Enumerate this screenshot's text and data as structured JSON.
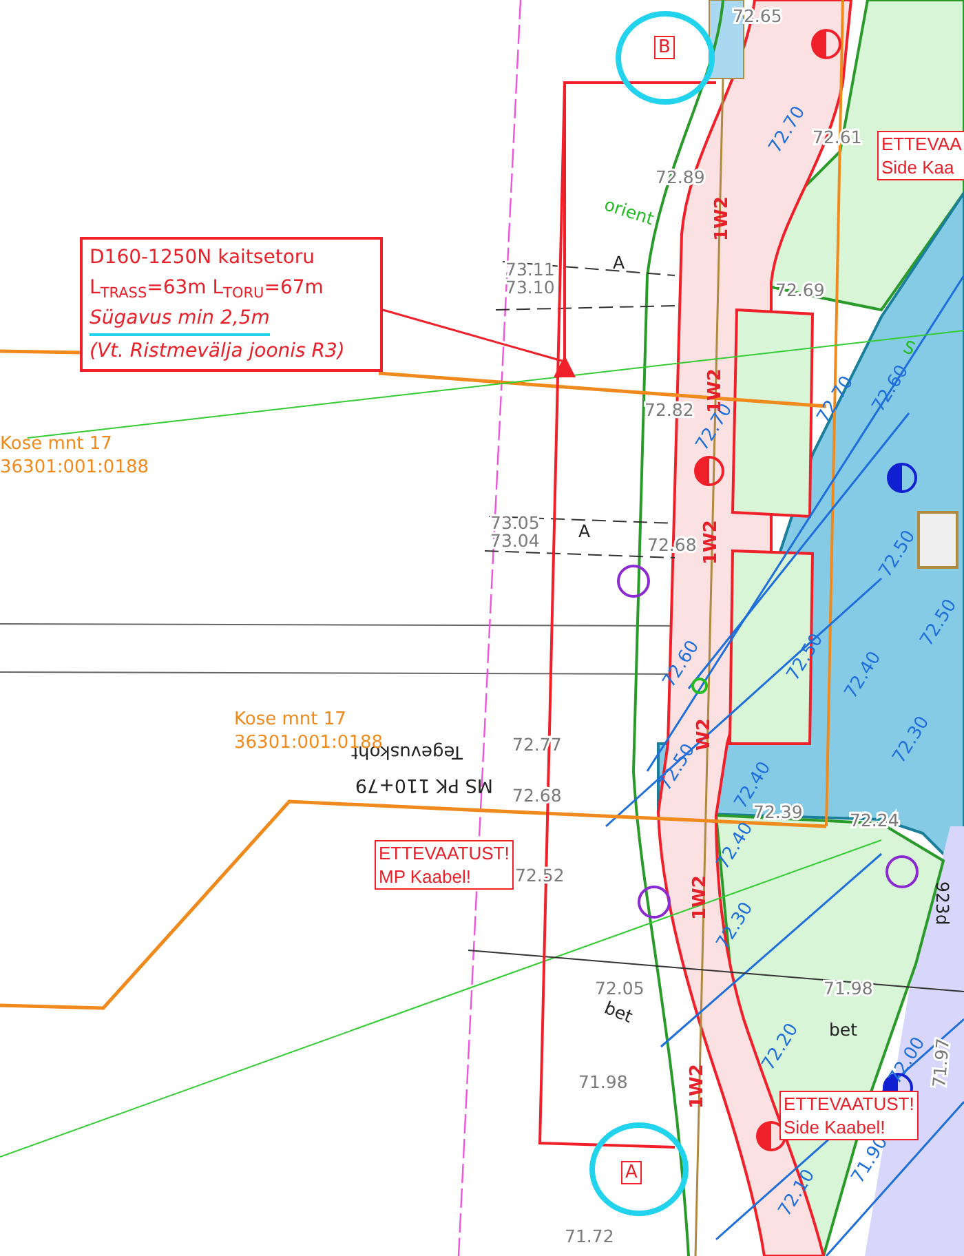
{
  "callout": {
    "lines": [
      {
        "text": "D160-1250N kaitsetoru",
        "italic": false,
        "highlighted": false
      },
      {
        "text": "L$_{TRASS}$=63m L$_{TORU}$=67m",
        "italic": false,
        "highlighted": false
      },
      {
        "text": "Sügavus min 2,5m",
        "italic": true,
        "highlighted": true
      },
      {
        "text": "(Vt. Ristmevälja joonis R3)",
        "italic": true,
        "highlighted": false
      }
    ]
  },
  "parcels": [
    {
      "name": "Kose mnt 17",
      "id": "36301:001:0188"
    },
    {
      "name": "Kose mnt 17",
      "id": "36301:001:0188"
    }
  ],
  "warnings": [
    {
      "title": "ETTEVAA",
      "text": "Side Kaa"
    },
    {
      "title": "ETTEVAATUST!",
      "text": "MP Kaabel!"
    },
    {
      "title": "ETTEVAATUST!",
      "text": "Side Kaabel!"
    }
  ],
  "point_markers": [
    {
      "label": "B",
      "circled": true
    },
    {
      "label": "A",
      "circled": true
    }
  ],
  "station": {
    "place": "Tegevuskoht",
    "chainage": "MS PK 110+79"
  },
  "elevations": [
    "72.65",
    "72.61",
    "72.89",
    "73.11",
    "73.10",
    "72.69",
    "72.82",
    "73.05",
    "73.04",
    "72.68",
    "72.77",
    "72.68",
    "72.52",
    "72.05",
    "71.98",
    "71.98",
    "72.39",
    "72.24",
    "71.72",
    "71.97"
  ],
  "contours": [
    "72.70",
    "72.70",
    "72.70",
    "72.60",
    "72.50",
    "72.60",
    "72.50",
    "72.40",
    "72.50",
    "72.30",
    "72.50",
    "72.40",
    "72.40",
    "72.30",
    "72.20",
    "72.10",
    "72.00",
    "71.90"
  ],
  "pipe_labels": [
    "1W2",
    "1W2",
    "1W2",
    "W2",
    "1W2",
    "1W2"
  ],
  "misc_labels": [
    {
      "kind": "green",
      "text": "orient"
    },
    {
      "kind": "green",
      "text": "S"
    },
    {
      "kind": "dark",
      "text": "A"
    },
    {
      "kind": "dark",
      "text": "A"
    },
    {
      "kind": "dark",
      "text": "bet"
    },
    {
      "kind": "dark",
      "text": "bet"
    },
    {
      "kind": "dark",
      "text": "923d"
    }
  ]
}
